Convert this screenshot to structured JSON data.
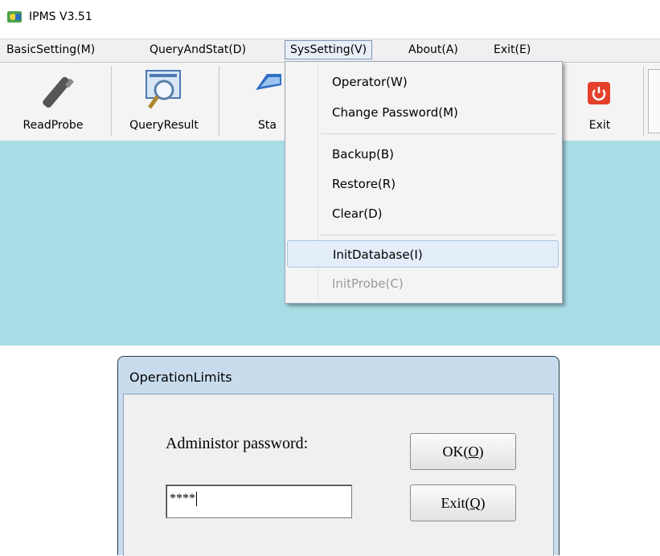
{
  "window": {
    "title": "IPMS V3.51",
    "icon": "app-logo-icon"
  },
  "menubar": {
    "items": [
      {
        "label": "BasicSetting(M)"
      },
      {
        "label": "QueryAndStat(D)"
      },
      {
        "label": "SysSetting(V)"
      },
      {
        "label": "About(A)"
      },
      {
        "label": "Exit(E)"
      }
    ]
  },
  "toolbar": {
    "buttons": [
      {
        "label": "ReadProbe",
        "icon": "probe-pen-icon"
      },
      {
        "label": "QueryResult",
        "icon": "magnifier-icon"
      },
      {
        "label": "Sta",
        "icon": "stat-icon"
      },
      {
        "label": "Exit",
        "icon": "power-icon"
      }
    ]
  },
  "dropdown": {
    "items": [
      {
        "label": "Operator(W)"
      },
      {
        "label": "Change Password(M)"
      },
      {
        "label": "Backup(B)"
      },
      {
        "label": "Restore(R)"
      },
      {
        "label": "Clear(D)"
      },
      {
        "label": "InitDatabase(I)",
        "state": "highlighted"
      },
      {
        "label": "InitProbe(C)",
        "state": "disabled"
      }
    ]
  },
  "dialog": {
    "title": "OperationLimits",
    "password_label": "Administor password:",
    "password_value": "****",
    "ok_label": "OK(",
    "ok_hotkey": "O",
    "exit_label": "Exit(",
    "exit_hotkey": "Q",
    "close_paren": ")"
  },
  "colors": {
    "workspace": "#a9dde6",
    "dialog_frame": "#c9dcee",
    "exit_icon": "#e4412b"
  }
}
